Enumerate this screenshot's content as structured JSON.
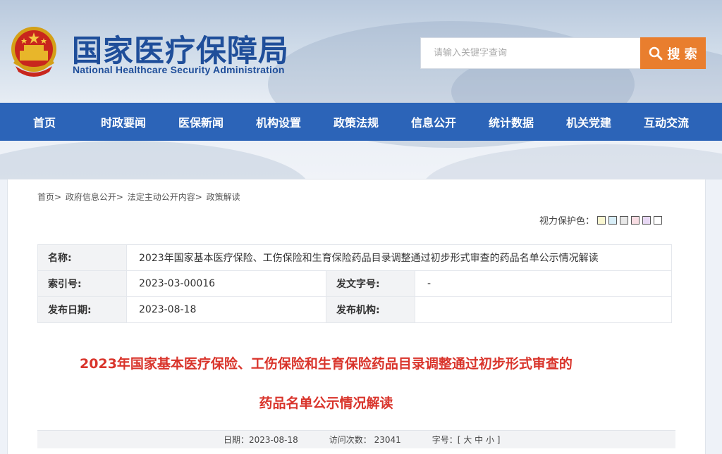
{
  "header": {
    "title_cn": "国家医疗保障局",
    "title_en": "National Healthcare Security Administration",
    "emblem_icon": "national-emblem-icon"
  },
  "search": {
    "placeholder": "请输入关键字查询",
    "button_label": "搜 索",
    "button_icon": "search-icon",
    "button_color": "#e97e2e"
  },
  "nav": {
    "color": "#2c64b8",
    "items": [
      "首页",
      "时政要闻",
      "医保新闻",
      "机构设置",
      "政策法规",
      "信息公开",
      "统计数据",
      "机关党建",
      "互动交流"
    ]
  },
  "breadcrumb": [
    "首页>",
    "政府信息公开>",
    "法定主动公开内容>",
    "政策解读"
  ],
  "eye_protect": {
    "label": "视力保护色：",
    "colors": [
      "#faf7d1",
      "#d8eef8",
      "#e8e8e8",
      "#f8dde3",
      "#e8d8f4",
      "#ffffff"
    ]
  },
  "meta": {
    "name_label": "名称:",
    "name_value": "2023年国家基本医疗保险、工伤保险和生育保险药品目录调整通过初步形式审查的药品名单公示情况解读",
    "index_label": "索引号:",
    "index_value": "2023-03-00016",
    "doc_no_label": "发文字号:",
    "doc_no_value": "-",
    "date_label": "发布日期:",
    "date_value": "2023-08-18",
    "org_label": "发布机构:",
    "org_value": ""
  },
  "article": {
    "title_line1": "2023年国家基本医疗保险、工伤保险和生育保险药品目录调整通过初步形式审查的",
    "title_line2": "药品名单公示情况解读",
    "title_color": "#d9342b"
  },
  "info": {
    "date": "日期：2023-08-18",
    "visits": "访问次数：  23041",
    "font_label": "字号：",
    "font_sizes": [
      "[ 大",
      "中",
      "小 ]"
    ]
  }
}
